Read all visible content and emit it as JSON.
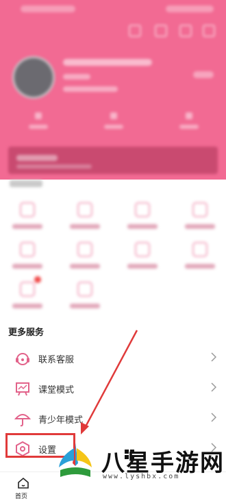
{
  "more_services": {
    "title": "更多服务",
    "items": [
      {
        "label": "联系客服",
        "icon": "headset-icon"
      },
      {
        "label": "课堂模式",
        "icon": "classroom-icon"
      },
      {
        "label": "青少年模式",
        "icon": "umbrella-icon"
      },
      {
        "label": "设置",
        "icon": "hexagon-settings-icon"
      }
    ]
  },
  "bottom_nav": {
    "home_label": "首页"
  },
  "watermark": {
    "text": "八星手游网",
    "url": "www.lyshbx.com"
  },
  "colors": {
    "header_pink": "#f26a93",
    "accent_pink": "#e2628a",
    "highlight_red": "#e03a3a"
  }
}
